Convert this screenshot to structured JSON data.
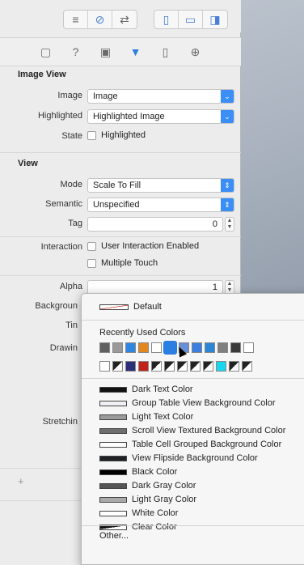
{
  "toolbar": {
    "left_group": [
      "align-left-icon",
      "link-icon",
      "back-forward-icon"
    ],
    "right_group": [
      "navigator-panel-icon",
      "debug-panel-icon",
      "utility-panel-icon"
    ]
  },
  "inspector_tabs": [
    "file-icon",
    "help-icon",
    "identity-icon",
    "attributes-icon",
    "size-icon",
    "connections-icon"
  ],
  "image_view": {
    "header": "Image View",
    "image_label": "Image",
    "image_placeholder": "Image",
    "highlighted_label": "Highlighted",
    "highlighted_placeholder": "Highlighted Image",
    "state_label": "State",
    "state_checkbox": "Highlighted"
  },
  "view": {
    "header": "View",
    "mode_label": "Mode",
    "mode_value": "Scale To Fill",
    "semantic_label": "Semantic",
    "semantic_value": "Unspecified",
    "tag_label": "Tag",
    "tag_value": "0",
    "interaction_label": "Interaction",
    "user_interaction": "User Interaction Enabled",
    "multiple_touch": "Multiple Touch",
    "alpha_label": "Alpha",
    "alpha_value": "1",
    "background_label": "Backgroun",
    "tint_label": "Tin",
    "drawing_label": "Drawin",
    "stretching_label": "Stretchin"
  },
  "color_menu": {
    "default_label": "Default",
    "recent_title": "Recently Used Colors",
    "recent_row1": [
      "#5f5f5f",
      "#9a9a9a",
      "#2f86e0",
      "#e3871d",
      "#ffffff",
      "#2a7fe0",
      "#6b8ed8",
      "#3b7fe0",
      "#2b86d6",
      "#7f7f7f",
      "#3a3a3a",
      "#ffffff"
    ],
    "recent_row2": [
      "#ffffff",
      "half",
      "#2b2f78",
      "#c0231b",
      "half",
      "half",
      "half",
      "half",
      "half",
      "#19d6ee",
      "half",
      "half"
    ],
    "named_colors": [
      {
        "label": "Dark Text Color",
        "color": "#111111"
      },
      {
        "label": "Group Table View Background Color",
        "color": "#efeff4"
      },
      {
        "label": "Light Text Color",
        "color": "#9a9a9a"
      },
      {
        "label": "Scroll View Textured Background Color",
        "color": "#6e6e6e"
      },
      {
        "label": "Table Cell Grouped Background Color",
        "color": "#ffffff"
      },
      {
        "label": "View Flipside Background Color",
        "color": "#1f2124"
      },
      {
        "label": "Black Color",
        "color": "#000000"
      },
      {
        "label": "Dark Gray Color",
        "color": "#555555"
      },
      {
        "label": "Light Gray Color",
        "color": "#aaaaaa"
      },
      {
        "label": "White Color",
        "color": "#ffffff"
      },
      {
        "label": "Clear Color",
        "color": "clear"
      }
    ],
    "other_label": "Other..."
  }
}
